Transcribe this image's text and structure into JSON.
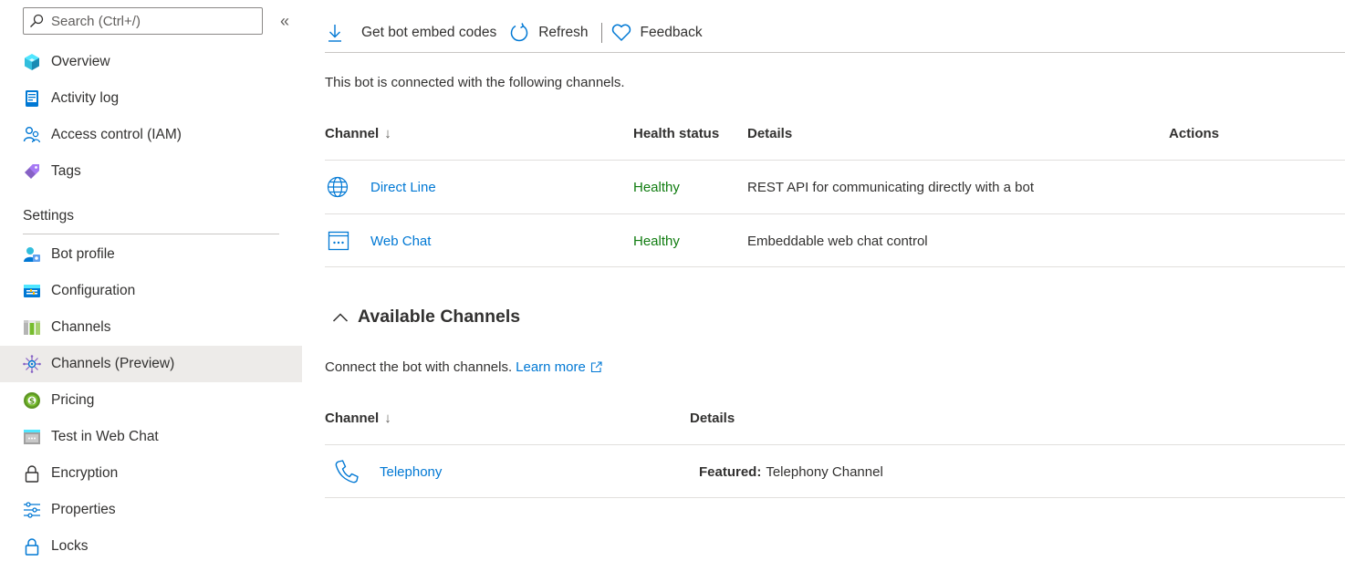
{
  "sidebar": {
    "search_placeholder": "Search (Ctrl+/)",
    "collapse_glyph": "«",
    "top_items": [
      {
        "label": "Overview",
        "icon": "overview-icon"
      },
      {
        "label": "Activity log",
        "icon": "activity-log-icon"
      },
      {
        "label": "Access control (IAM)",
        "icon": "access-control-icon"
      },
      {
        "label": "Tags",
        "icon": "tag-icon"
      }
    ],
    "settings_header": "Settings",
    "settings_items": [
      {
        "label": "Bot profile",
        "icon": "bot-profile-icon"
      },
      {
        "label": "Configuration",
        "icon": "configuration-icon"
      },
      {
        "label": "Channels",
        "icon": "channels-icon"
      },
      {
        "label": "Channels (Preview)",
        "icon": "channels-preview-icon",
        "active": true
      },
      {
        "label": "Pricing",
        "icon": "pricing-icon"
      },
      {
        "label": "Test in Web Chat",
        "icon": "test-web-chat-icon"
      },
      {
        "label": "Encryption",
        "icon": "lock-icon"
      },
      {
        "label": "Properties",
        "icon": "properties-icon"
      },
      {
        "label": "Locks",
        "icon": "lock-icon"
      }
    ]
  },
  "toolbar": {
    "embed_label": "Get bot embed codes",
    "refresh_label": "Refresh",
    "feedback_label": "Feedback"
  },
  "connected": {
    "intro": "This bot is connected with the following channels.",
    "headers": {
      "channel": "Channel",
      "sort_arrow": "↓",
      "health": "Health status",
      "details": "Details",
      "actions": "Actions"
    },
    "rows": [
      {
        "name": "Direct Line",
        "icon": "globe-icon",
        "health": "Healthy",
        "details": "REST API for communicating directly with a bot"
      },
      {
        "name": "Web Chat",
        "icon": "web-chat-icon",
        "health": "Healthy",
        "details": "Embeddable web chat control"
      }
    ]
  },
  "available": {
    "title": "Available Channels",
    "connect_text": "Connect the bot with channels.",
    "learn_more": "Learn more",
    "headers": {
      "channel": "Channel",
      "sort_arrow": "↓",
      "details": "Details"
    },
    "rows": [
      {
        "name": "Telephony",
        "icon": "phone-icon",
        "details_bold": "Featured:",
        "details": "Telephony Channel"
      }
    ]
  },
  "colors": {
    "link": "#0078d4",
    "healthy": "#107c10",
    "active_bg": "#edebe9"
  }
}
